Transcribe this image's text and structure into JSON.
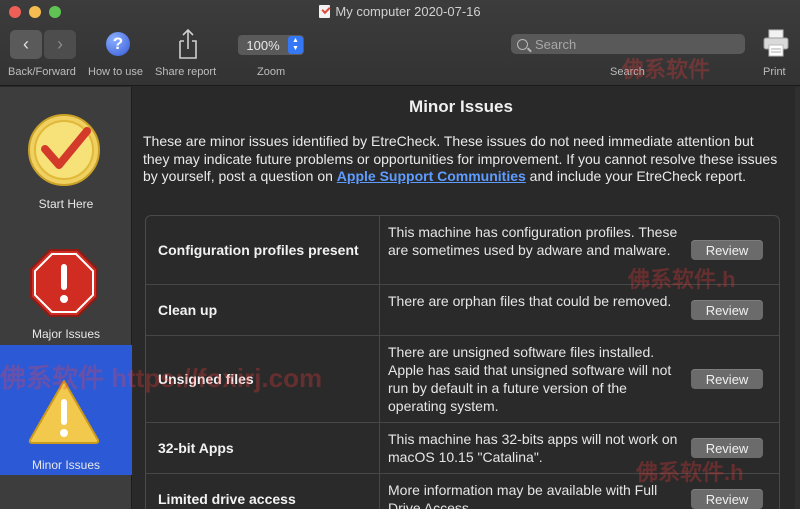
{
  "window": {
    "title": "My computer 2020-07-16"
  },
  "toolbar": {
    "back_forward_label": "Back/Forward",
    "how_to_use_label": "How to use",
    "share_report_label": "Share report",
    "zoom_value": "100%",
    "zoom_label": "Zoom",
    "search_placeholder": "Search",
    "search_label": "Search",
    "print_label": "Print"
  },
  "sidebar": {
    "items": [
      {
        "label": "Start Here",
        "icon": "checkmark-badge-icon",
        "selected": false
      },
      {
        "label": "Major Issues",
        "icon": "stop-sign-icon",
        "selected": false
      },
      {
        "label": "Minor Issues",
        "icon": "warning-triangle-icon",
        "selected": true
      }
    ]
  },
  "main": {
    "heading": "Minor Issues",
    "intro_before_link": "These are minor issues identified by EtreCheck. These issues do not need immediate attention but they may indicate future problems or opportunities for improvement. If you cannot resolve these issues by yourself, post a question on ",
    "intro_link": "Apple Support Communities",
    "intro_after_link": " and include your EtreCheck report.",
    "review_label": "Review",
    "issues": [
      {
        "title": "Configuration profiles present",
        "description": "This machine has configuration profiles. These are sometimes used by adware and malware."
      },
      {
        "title": "Clean up",
        "description": "There are orphan files that could be removed."
      },
      {
        "title": "Unsigned files",
        "description": "There are unsigned software files installed. Apple has said that unsigned software will not run by default in a future version of the operating system."
      },
      {
        "title": "32-bit Apps",
        "description": "This machine has 32-bits apps will not work on macOS 10.15 \"Catalina\"."
      },
      {
        "title": "Limited drive access",
        "description": "More information may be available with Full Drive Access."
      }
    ]
  },
  "watermark": {
    "text1": "佛系软件 https://foxirj.com",
    "text2": "佛系软件",
    "text3": "佛系软件.h"
  },
  "colors": {
    "accent_selected": "#2c59d6",
    "link": "#5e9cff"
  }
}
